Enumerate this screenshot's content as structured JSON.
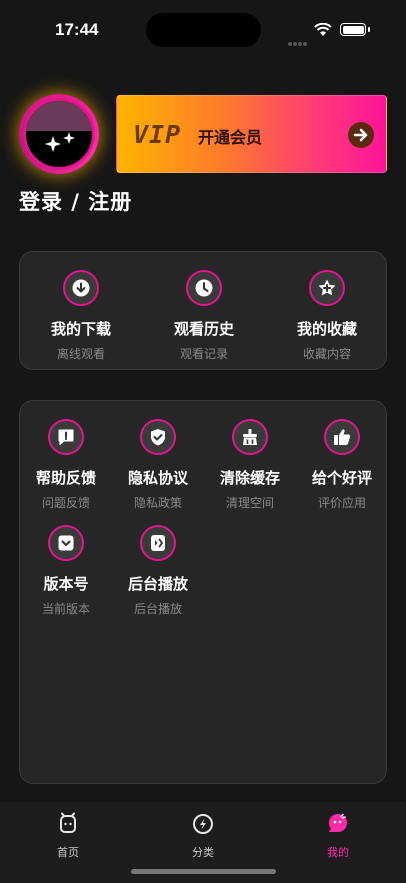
{
  "status": {
    "time": "17:44"
  },
  "profile": {
    "login_label": "登录 / 注册"
  },
  "vip": {
    "badge": "VIP",
    "label": "开通会员"
  },
  "quick": [
    {
      "label": "我的下载",
      "sub": "离线观看",
      "icon": "download-icon"
    },
    {
      "label": "观看历史",
      "sub": "观看记录",
      "icon": "clock-icon"
    },
    {
      "label": "我的收藏",
      "sub": "收藏内容",
      "icon": "star-icon"
    }
  ],
  "tools": [
    {
      "label": "帮助反馈",
      "sub": "问题反馈",
      "icon": "feedback-icon"
    },
    {
      "label": "隐私协议",
      "sub": "隐私政策",
      "icon": "shield-icon"
    },
    {
      "label": "清除缓存",
      "sub": "清理空间",
      "icon": "broom-icon"
    },
    {
      "label": "给个好评",
      "sub": "评价应用",
      "icon": "thumbs-up-icon"
    },
    {
      "label": "版本号",
      "sub": "当前版本",
      "icon": "chevron-down-icon"
    },
    {
      "label": "后台播放",
      "sub": "后台播放",
      "icon": "background-play-icon"
    }
  ],
  "tabs": [
    {
      "label": "首页",
      "icon": "home-icon"
    },
    {
      "label": "分类",
      "icon": "compass-icon"
    },
    {
      "label": "我的",
      "icon": "profile-icon"
    }
  ],
  "colors": {
    "accent": "#e2168c",
    "active_tab": "#ff2aa8",
    "background": "#161616"
  }
}
